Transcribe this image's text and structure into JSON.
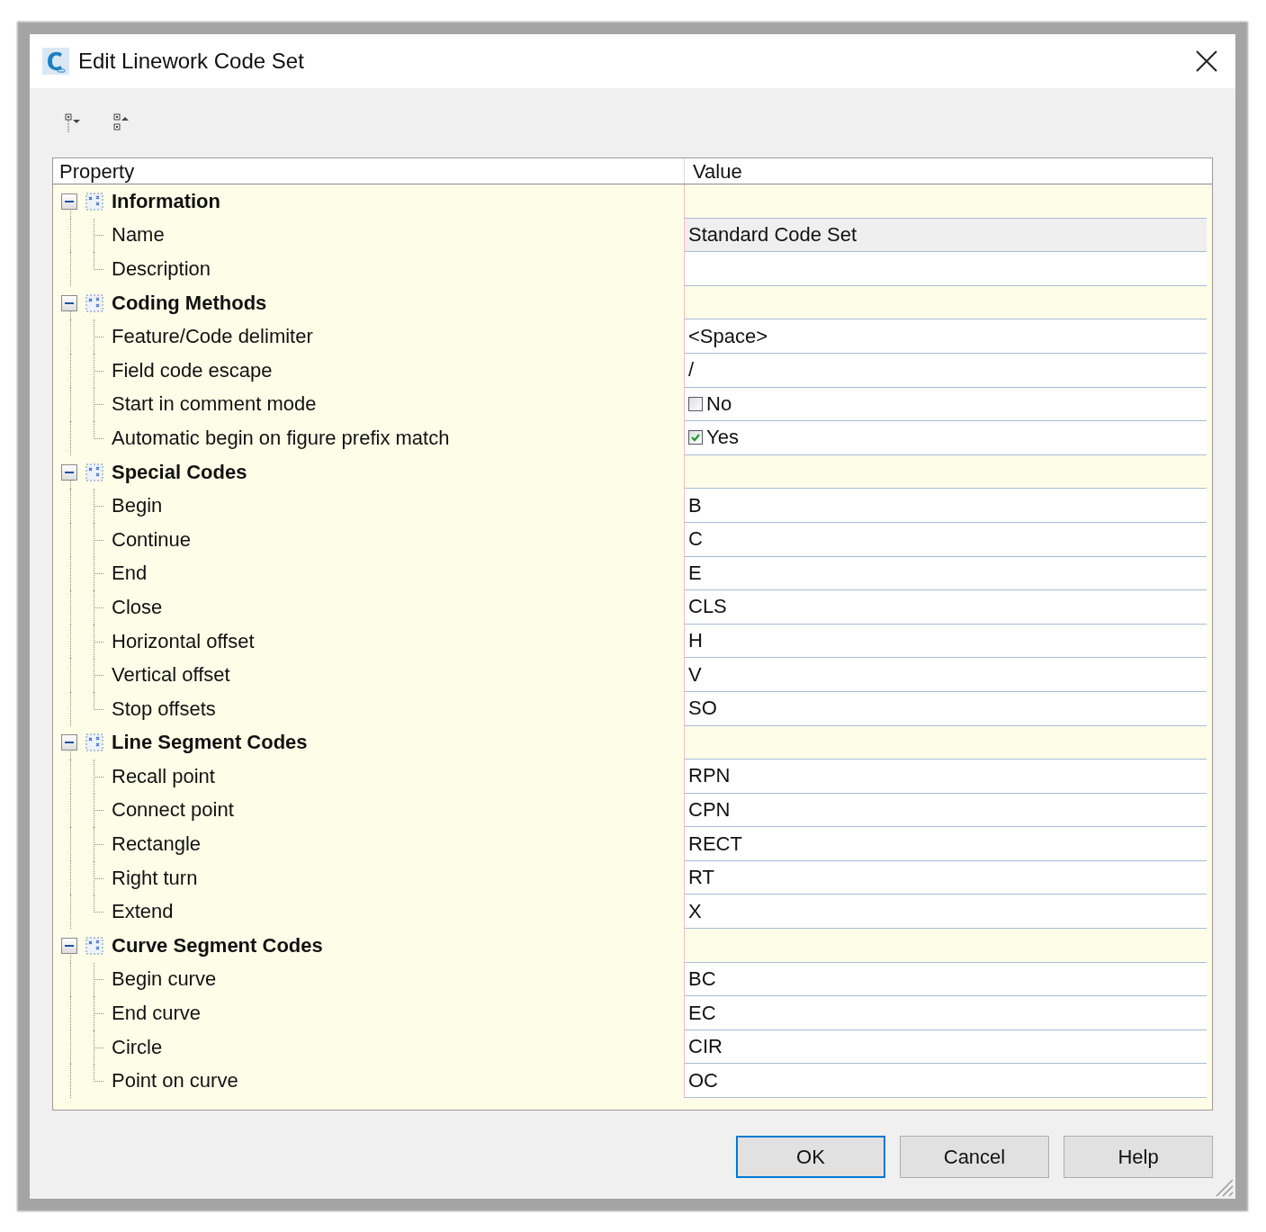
{
  "window": {
    "title": "Edit Linework Code Set"
  },
  "grid": {
    "columns": [
      "Property",
      "Value"
    ],
    "categories": [
      {
        "name": "Information",
        "expanded": true,
        "properties": [
          {
            "name": "Name",
            "kind": "text",
            "value": "Standard Code Set",
            "readonly": true
          },
          {
            "name": "Description",
            "kind": "text",
            "readonly": false
          }
        ]
      },
      {
        "name": "Coding Methods",
        "expanded": true,
        "properties": [
          {
            "name": "Feature/Code delimiter",
            "kind": "text",
            "value": "<Space>",
            "readonly": false
          },
          {
            "name": "Field code escape",
            "kind": "text",
            "value": "/",
            "readonly": false
          },
          {
            "name": "Start in comment mode",
            "kind": "checkbox",
            "value": "No",
            "checked": false,
            "readonly": false
          },
          {
            "name": "Automatic begin on figure prefix match",
            "kind": "checkbox",
            "value": "Yes",
            "checked": true,
            "readonly": false
          }
        ]
      },
      {
        "name": "Special Codes",
        "expanded": true,
        "properties": [
          {
            "name": "Begin",
            "kind": "text",
            "value": "B",
            "readonly": false
          },
          {
            "name": "Continue",
            "kind": "text",
            "value": "C",
            "readonly": false
          },
          {
            "name": "End",
            "kind": "text",
            "value": "E",
            "readonly": false
          },
          {
            "name": "Close",
            "kind": "text",
            "value": "CLS",
            "readonly": false
          },
          {
            "name": "Horizontal offset",
            "kind": "text",
            "value": "H",
            "readonly": false
          },
          {
            "name": "Vertical offset",
            "kind": "text",
            "value": "V",
            "readonly": false
          },
          {
            "name": "Stop offsets",
            "kind": "text",
            "value": "SO",
            "readonly": false
          }
        ]
      },
      {
        "name": "Line Segment Codes",
        "expanded": true,
        "properties": [
          {
            "name": "Recall point",
            "kind": "text",
            "value": "RPN",
            "readonly": false
          },
          {
            "name": "Connect point",
            "kind": "text",
            "value": "CPN",
            "readonly": false
          },
          {
            "name": "Rectangle",
            "kind": "text",
            "value": "RECT",
            "readonly": false
          },
          {
            "name": "Right turn",
            "kind": "text",
            "value": "RT",
            "readonly": false
          },
          {
            "name": "Extend",
            "kind": "text",
            "value": "X",
            "readonly": false
          }
        ]
      },
      {
        "name": "Curve Segment Codes",
        "expanded": true,
        "properties": [
          {
            "name": "Begin curve",
            "kind": "text",
            "value": "BC",
            "readonly": false
          },
          {
            "name": "End curve",
            "kind": "text",
            "value": "EC",
            "readonly": false
          },
          {
            "name": "Circle",
            "kind": "text",
            "value": "CIR",
            "readonly": false
          },
          {
            "name": "Point on curve",
            "kind": "text",
            "value": "OC",
            "readonly": false
          }
        ]
      }
    ]
  },
  "buttons": [
    {
      "label": "OK",
      "selected": true
    },
    {
      "label": "Cancel",
      "selected": false
    },
    {
      "label": "Help",
      "selected": false
    }
  ]
}
